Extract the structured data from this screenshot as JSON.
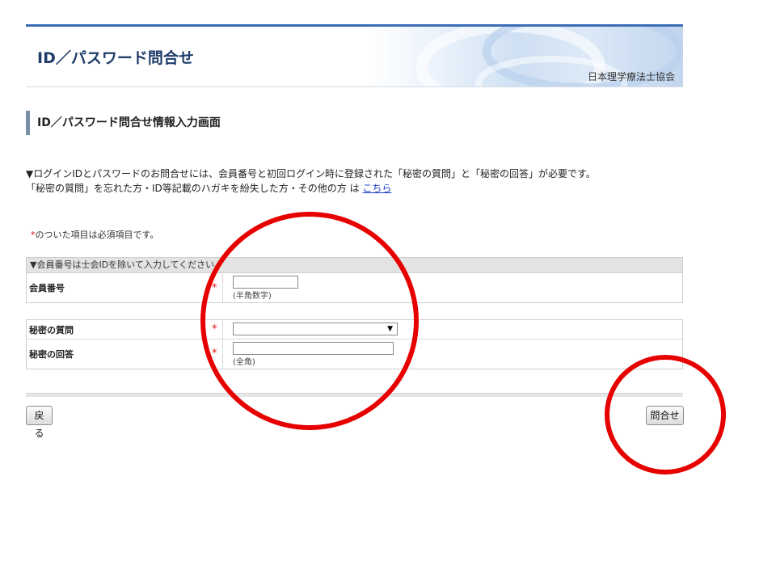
{
  "banner": {
    "title": "ID／パスワード問合せ",
    "org": "日本理学療法士協会"
  },
  "section": {
    "heading": "ID／パスワード問合せ情報入力画面"
  },
  "notice": {
    "line1": "▼ログインIDとパスワードのお問合せには、会員番号と初回ログイン時に登録された「秘密の質問」と「秘密の回答」が必要です。",
    "line2_prefix": "「秘密の質問」を忘れた方・ID等記載のハガキを紛失した方・その他の方 は ",
    "link": "こちら"
  },
  "required_note": {
    "star": "*",
    "text": "のついた項目は必須項目です。"
  },
  "form1": {
    "caption": "▼会員番号は士会IDを除いて入力してください。",
    "member_label": "会員番号",
    "member_hint": "(半角数字)",
    "member_value": ""
  },
  "form2": {
    "question_label": "秘密の質問",
    "question_selected": "",
    "answer_label": "秘密の回答",
    "answer_hint": "(全角)",
    "answer_value": ""
  },
  "required_mark": "*",
  "buttons": {
    "back": "戻る",
    "submit": "問合せ"
  },
  "icons": {
    "select_arrow": "▼"
  },
  "colors": {
    "annotation_circle": "#e60000",
    "banner_accent": "#3a6db5",
    "required": "#e01010"
  }
}
